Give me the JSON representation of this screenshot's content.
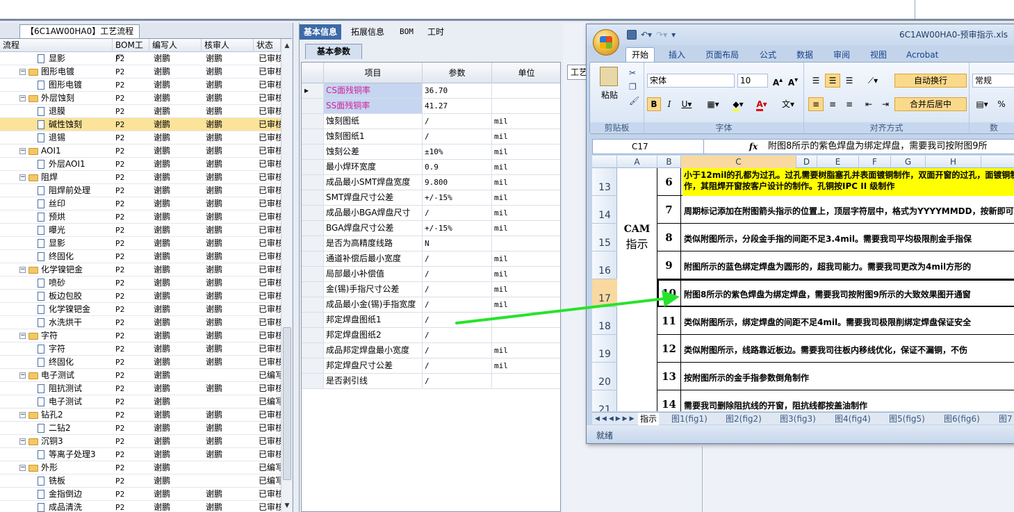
{
  "flow_tab": "【6C1AW00HA0】工艺流程",
  "left_tree": {
    "headers": [
      "流程",
      "BOM工厂",
      "编写人",
      "核审人",
      "状态"
    ],
    "rows": [
      {
        "level": 2,
        "type": "step",
        "name": "显影",
        "bom": "P2",
        "author": "谢鹏",
        "reviewer": "谢鹏",
        "status": "已审核"
      },
      {
        "level": 1,
        "type": "folder",
        "name": "图形电镀",
        "bom": "P2",
        "author": "谢鹏",
        "reviewer": "谢鹏",
        "status": "已审核"
      },
      {
        "level": 2,
        "type": "step",
        "name": "图形电镀",
        "bom": "P2",
        "author": "谢鹏",
        "reviewer": "谢鹏",
        "status": "已审核"
      },
      {
        "level": 1,
        "type": "folder",
        "name": "外层蚀刻",
        "bom": "P2",
        "author": "谢鹏",
        "reviewer": "谢鹏",
        "status": "已审核"
      },
      {
        "level": 2,
        "type": "step",
        "name": "退膜",
        "bom": "P2",
        "author": "谢鹏",
        "reviewer": "谢鹏",
        "status": "已审核"
      },
      {
        "level": 2,
        "type": "step",
        "name": "碱性蚀刻",
        "bom": "P2",
        "author": "谢鹏",
        "reviewer": "谢鹏",
        "status": "已审核",
        "selected": true
      },
      {
        "level": 2,
        "type": "step",
        "name": "退锡",
        "bom": "P2",
        "author": "谢鹏",
        "reviewer": "谢鹏",
        "status": "已审核"
      },
      {
        "level": 1,
        "type": "folder",
        "name": "AOI1",
        "bom": "P2",
        "author": "谢鹏",
        "reviewer": "谢鹏",
        "status": "已审核"
      },
      {
        "level": 2,
        "type": "step",
        "name": "外层AOI1",
        "bom": "P2",
        "author": "谢鹏",
        "reviewer": "谢鹏",
        "status": "已审核"
      },
      {
        "level": 1,
        "type": "folder",
        "name": "阻焊",
        "bom": "P2",
        "author": "谢鹏",
        "reviewer": "谢鹏",
        "status": "已审核"
      },
      {
        "level": 2,
        "type": "step",
        "name": "阻焊前处理",
        "bom": "P2",
        "author": "谢鹏",
        "reviewer": "谢鹏",
        "status": "已审核"
      },
      {
        "level": 2,
        "type": "step",
        "name": "丝印",
        "bom": "P2",
        "author": "谢鹏",
        "reviewer": "谢鹏",
        "status": "已审核"
      },
      {
        "level": 2,
        "type": "step",
        "name": "预烘",
        "bom": "P2",
        "author": "谢鹏",
        "reviewer": "谢鹏",
        "status": "已审核"
      },
      {
        "level": 2,
        "type": "step",
        "name": "曝光",
        "bom": "P2",
        "author": "谢鹏",
        "reviewer": "谢鹏",
        "status": "已审核"
      },
      {
        "level": 2,
        "type": "step",
        "name": "显影",
        "bom": "P2",
        "author": "谢鹏",
        "reviewer": "谢鹏",
        "status": "已审核"
      },
      {
        "level": 2,
        "type": "step",
        "name": "终固化",
        "bom": "P2",
        "author": "谢鹏",
        "reviewer": "谢鹏",
        "status": "已审核"
      },
      {
        "level": 1,
        "type": "folder",
        "name": "化学镍钯金",
        "bom": "P2",
        "author": "谢鹏",
        "reviewer": "谢鹏",
        "status": "已审核"
      },
      {
        "level": 2,
        "type": "step",
        "name": "喷砂",
        "bom": "P2",
        "author": "谢鹏",
        "reviewer": "谢鹏",
        "status": "已审核"
      },
      {
        "level": 2,
        "type": "step",
        "name": "板边包胶",
        "bom": "P2",
        "author": "谢鹏",
        "reviewer": "谢鹏",
        "status": "已审核"
      },
      {
        "level": 2,
        "type": "step",
        "name": "化学镍钯金",
        "bom": "P2",
        "author": "谢鹏",
        "reviewer": "谢鹏",
        "status": "已审核"
      },
      {
        "level": 2,
        "type": "step",
        "name": "水洗烘干",
        "bom": "P2",
        "author": "谢鹏",
        "reviewer": "谢鹏",
        "status": "已审核"
      },
      {
        "level": 1,
        "type": "folder",
        "name": "字符",
        "bom": "P2",
        "author": "谢鹏",
        "reviewer": "谢鹏",
        "status": "已审核"
      },
      {
        "level": 2,
        "type": "step",
        "name": "字符",
        "bom": "P2",
        "author": "谢鹏",
        "reviewer": "谢鹏",
        "status": "已审核"
      },
      {
        "level": 2,
        "type": "step",
        "name": "终固化",
        "bom": "P2",
        "author": "谢鹏",
        "reviewer": "谢鹏",
        "status": "已审核"
      },
      {
        "level": 1,
        "type": "folder",
        "name": "电子测试",
        "bom": "P2",
        "author": "谢鹏",
        "reviewer": "",
        "status": "已编写"
      },
      {
        "level": 2,
        "type": "step",
        "name": "阻抗测试",
        "bom": "P2",
        "author": "谢鹏",
        "reviewer": "谢鹏",
        "status": "已审核"
      },
      {
        "level": 2,
        "type": "step",
        "name": "电子测试",
        "bom": "P2",
        "author": "谢鹏",
        "reviewer": "",
        "status": "已编写"
      },
      {
        "level": 1,
        "type": "folder",
        "name": "钻孔2",
        "bom": "P2",
        "author": "谢鹏",
        "reviewer": "谢鹏",
        "status": "已审核"
      },
      {
        "level": 2,
        "type": "step",
        "name": "二钻2",
        "bom": "P2",
        "author": "谢鹏",
        "reviewer": "谢鹏",
        "status": "已审核"
      },
      {
        "level": 1,
        "type": "folder",
        "name": "沉铜3",
        "bom": "P2",
        "author": "谢鹏",
        "reviewer": "谢鹏",
        "status": "已审核"
      },
      {
        "level": 2,
        "type": "step",
        "name": "等离子处理3",
        "bom": "P2",
        "author": "谢鹏",
        "reviewer": "谢鹏",
        "status": "已审核"
      },
      {
        "level": 1,
        "type": "folder",
        "name": "外形",
        "bom": "P2",
        "author": "谢鹏",
        "reviewer": "",
        "status": "已编写"
      },
      {
        "level": 2,
        "type": "step",
        "name": "铣板",
        "bom": "P2",
        "author": "谢鹏",
        "reviewer": "",
        "status": "已编写"
      },
      {
        "level": 2,
        "type": "step",
        "name": "金指倒边",
        "bom": "P2",
        "author": "谢鹏",
        "reviewer": "谢鹏",
        "status": "已审核"
      },
      {
        "level": 2,
        "type": "step",
        "name": "成品清洗",
        "bom": "P2",
        "author": "谢鹏",
        "reviewer": "谢鹏",
        "status": "已审核"
      }
    ]
  },
  "mid_tabs": [
    "基本信息",
    "拓展信息",
    "BOM",
    "工时"
  ],
  "param_tab": "基本参数",
  "param_grid": {
    "headers": [
      "项目",
      "参数",
      "单位"
    ],
    "rows": [
      {
        "name": "CS面残铜率",
        "value": "36.70",
        "unit": "",
        "highlight": true,
        "current": true
      },
      {
        "name": "SS面残铜率",
        "value": "41.27",
        "unit": "",
        "highlight": true
      },
      {
        "name": "蚀刻图纸",
        "value": "/",
        "unit": "mil"
      },
      {
        "name": "蚀刻图纸1",
        "value": "/",
        "unit": "mil"
      },
      {
        "name": "蚀刻公差",
        "value": "±10%",
        "unit": "mil"
      },
      {
        "name": "最小焊环宽度",
        "value": "0.9",
        "unit": "mil"
      },
      {
        "name": "成品最小SMT焊盘宽度",
        "value": "9.800",
        "unit": "mil"
      },
      {
        "name": "SMT焊盘尺寸公差",
        "value": "+/-15%",
        "unit": "mil"
      },
      {
        "name": "成品最小BGA焊盘尺寸",
        "value": "/",
        "unit": "mil"
      },
      {
        "name": "BGA焊盘尺寸公差",
        "value": "+/-15%",
        "unit": "mil"
      },
      {
        "name": "是否为高精度线路",
        "value": "N",
        "unit": ""
      },
      {
        "name": "通道补偿后最小宽度",
        "value": "/",
        "unit": "mil"
      },
      {
        "name": "局部最小补偿值",
        "value": "/",
        "unit": "mil"
      },
      {
        "name": "金(锡)手指尺寸公差",
        "value": "/",
        "unit": "mil"
      },
      {
        "name": "成品最小金(锡)手指宽度",
        "value": "/",
        "unit": "mil"
      },
      {
        "name": "邦定焊盘图纸1",
        "value": "/",
        "unit": ""
      },
      {
        "name": "邦定焊盘图纸2",
        "value": "/",
        "unit": ""
      },
      {
        "name": "成品邦定焊盘最小宽度",
        "value": "/",
        "unit": "mil"
      },
      {
        "name": "邦定焊盘尺寸公差",
        "value": "/",
        "unit": "mil"
      },
      {
        "name": "是否剥引线",
        "value": "/",
        "unit": ""
      }
    ]
  },
  "right_bg_tab": "工艺",
  "excel": {
    "filename": "6C1AW00HA0-预审指示.xls",
    "ribbon_tabs": [
      "开始",
      "插入",
      "页面布局",
      "公式",
      "数据",
      "审阅",
      "视图",
      "Acrobat"
    ],
    "clipboard": {
      "paste": "粘贴",
      "label": "剪贴板"
    },
    "font": {
      "name": "宋体",
      "size": "10",
      "label": "字体"
    },
    "align": {
      "wrap": "自动换行",
      "merge": "合并后居中",
      "label": "对齐方式"
    },
    "number": {
      "format": "常规",
      "label": "数"
    },
    "name_box": "C17",
    "formula": "附图8所示的紫色焊盘为绑定焊盘，需要我司按附图9所",
    "columns": [
      "A",
      "B",
      "C",
      "D",
      "E",
      "F",
      "G",
      "H"
    ],
    "row_numbers": [
      "13",
      "14",
      "15",
      "16",
      "17",
      "18",
      "19",
      "20",
      "21"
    ],
    "section": {
      "line1": "CAM",
      "line2": "指示"
    },
    "notes": [
      {
        "no": "6",
        "text": "小于12mil的孔都为过孔。过孔需要树脂塞孔并表面镀铜制作，双面开窗的过孔，面镀铜制作，其阻焊开窗按客户设计的制作。孔铜按IPC II 级制作",
        "yellow": true
      },
      {
        "no": "7",
        "text": "周期标记添加在附图箭头指示的位置上，顶层字符层中，格式为YYYYMMDD，按新即可（格式以YYYYMMDD为准）"
      },
      {
        "no": "8",
        "text": "类似附图所示，分段金手指的间距不足3.4mil。需要我司平均极限削金手指保"
      },
      {
        "no": "9",
        "text": "附图所示的蓝色绑定焊盘为圆形的，超我司能力。需要我司更改为4mil方形的"
      },
      {
        "no": "10",
        "text": "附图8所示的紫色焊盘为绑定焊盘，需要我司按附图9所示的大致效果图开通窗",
        "active": true
      },
      {
        "no": "11",
        "text": "类似附图所示，绑定焊盘的间距不足4mil。需要我司极限削绑定焊盘保证安全"
      },
      {
        "no": "12",
        "text": "类似附图所示，线路靠近板边。需要我司往板内移线优化，保证不漏铜，不伤"
      },
      {
        "no": "13",
        "text": "按附图所示的金手指参数倒角制作"
      },
      {
        "no": "14",
        "text": "需要我司删除阻抗线的开窗，阻抗线都按盖油制作"
      }
    ],
    "sheet_tabs": [
      "指示",
      "图1(fig1)",
      "图2(fig2)",
      "图3(fig3)",
      "图4(fig4)",
      "图5(fig5)",
      "图6(fig6)",
      "图7"
    ],
    "status": "就绪"
  },
  "colors": {
    "arrow": "#27e32b",
    "selected_row": "#fbe39a",
    "highlight_text": "#d0219a",
    "note_yellow": "#ffff00"
  }
}
